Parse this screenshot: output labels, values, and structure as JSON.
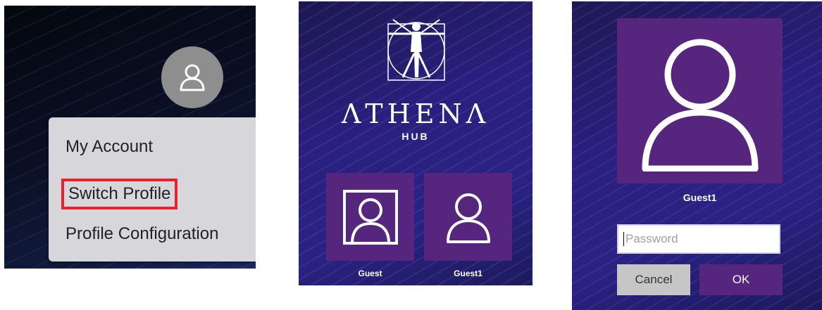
{
  "menu": {
    "items": [
      {
        "label": "My Account"
      },
      {
        "label": "Switch Profile"
      },
      {
        "label": "Profile Configuration"
      }
    ],
    "highlight_color": "#e8222c"
  },
  "hub": {
    "brand": "ΛTHENΛ",
    "subtitle": "HUB",
    "profiles": [
      {
        "name": "Guest",
        "icon": "user-framed-icon"
      },
      {
        "name": "Guest1",
        "icon": "user-icon"
      }
    ]
  },
  "login": {
    "username": "Guest1",
    "password_placeholder": "Password",
    "password_value": "",
    "cancel_label": "Cancel",
    "ok_label": "OK"
  },
  "colors": {
    "tile": "#56257e",
    "background": "#2a1f7e"
  }
}
